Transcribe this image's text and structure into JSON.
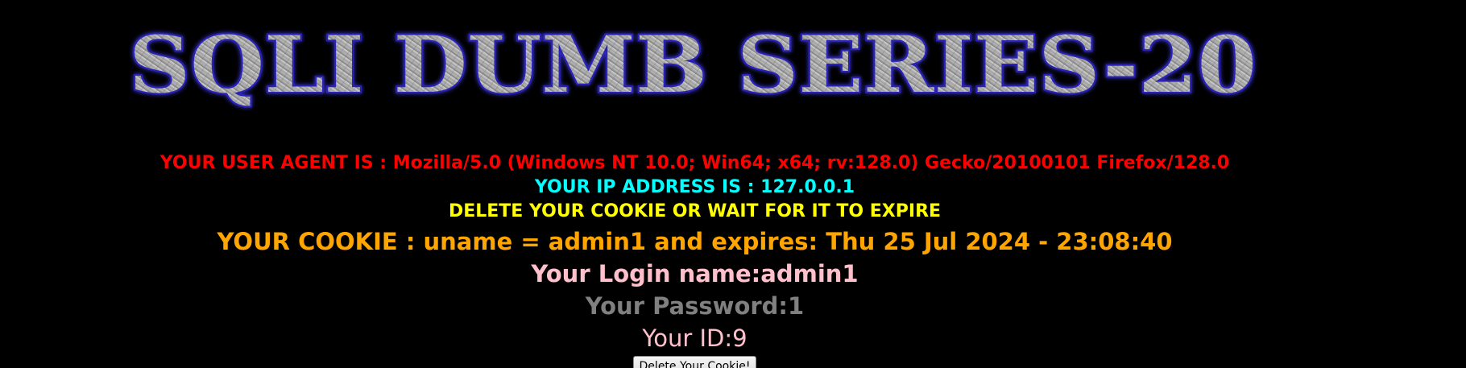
{
  "banner": {
    "title": "SQLI DUMB SERIES-20"
  },
  "info": {
    "user_agent": "YOUR USER AGENT IS : Mozilla/5.0 (Windows NT 10.0; Win64; x64; rv:128.0) Gecko/20100101 Firefox/128.0",
    "ip_address": "YOUR IP ADDRESS IS : 127.0.0.1",
    "delete_notice": "DELETE YOUR COOKIE OR WAIT FOR IT TO EXPIRE",
    "cookie": "YOUR COOKIE : uname = admin1 and expires: Thu 25 Jul 2024 - 23:08:40",
    "login_name": "Your Login name:admin1",
    "password": "Your Password:1",
    "id": "Your ID:9"
  },
  "actions": {
    "delete_cookie_label": "Delete Your Cookie!"
  },
  "colors": {
    "background": "#000000",
    "user_agent": "#ff0000",
    "ip_address": "#00ffff",
    "delete_notice": "#ffff00",
    "cookie": "#ffa500",
    "login_name": "#ffc0cb",
    "password": "#808080",
    "id": "#ffc0cb"
  }
}
